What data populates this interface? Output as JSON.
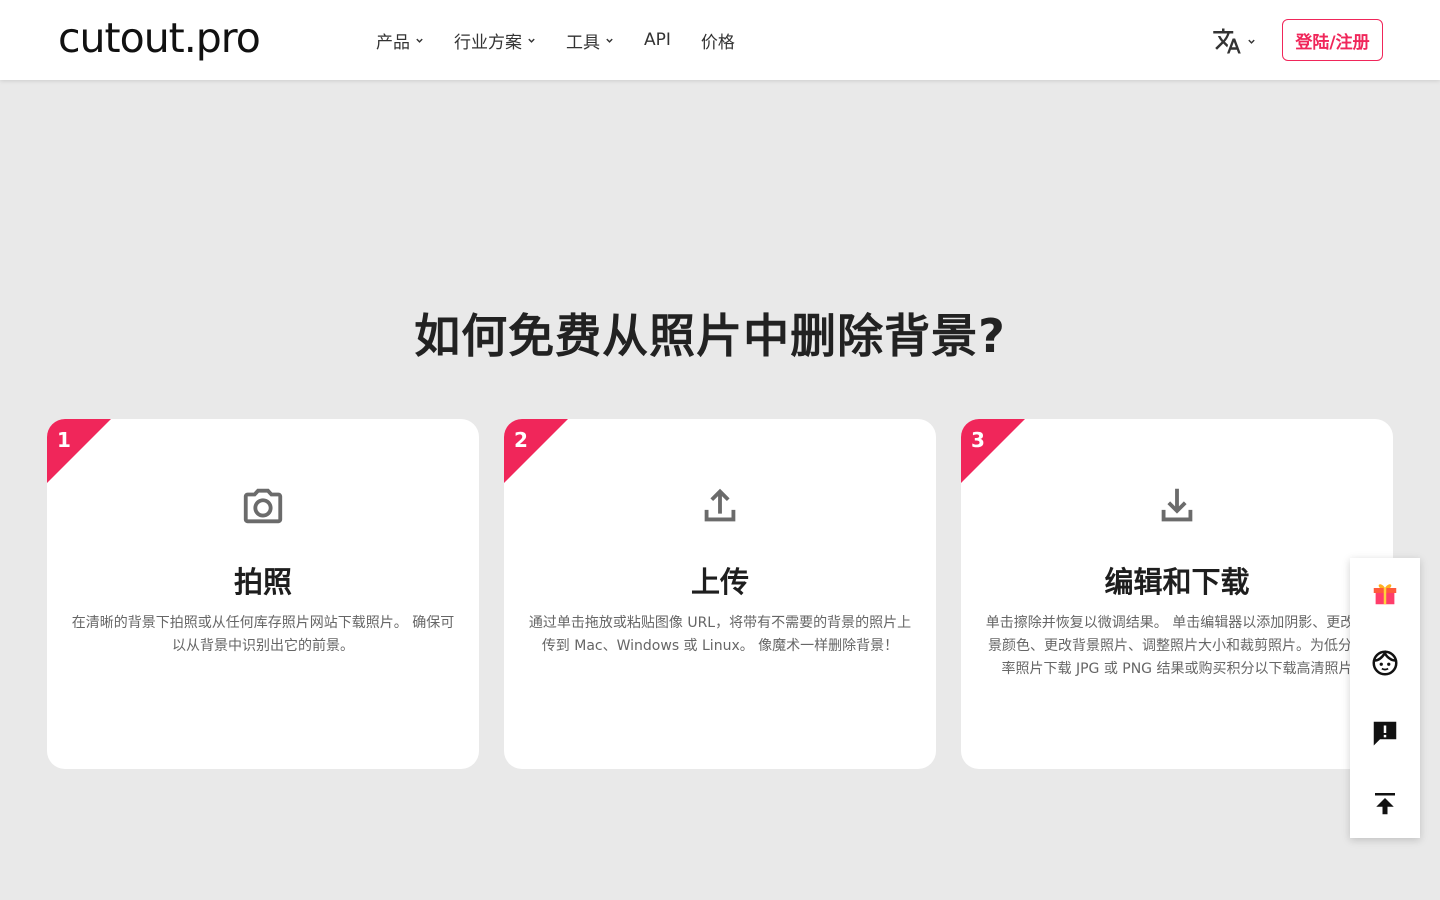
{
  "header": {
    "logo": "cutout.pro",
    "nav": [
      {
        "label": "产品",
        "has_dropdown": true
      },
      {
        "label": "行业方案",
        "has_dropdown": true
      },
      {
        "label": "工具",
        "has_dropdown": true
      },
      {
        "label": "API",
        "has_dropdown": false
      },
      {
        "label": "价格",
        "has_dropdown": false
      }
    ],
    "language_icon": "translate-icon",
    "login_label": "登陆/注册"
  },
  "section": {
    "title": "如何免费从照片中删除背景?"
  },
  "steps": [
    {
      "number": "1",
      "icon": "camera-icon",
      "title": "拍照",
      "description": "在清晰的背景下拍照或从任何库存照片网站下载照片。 确保可以从背景中识别出它的前景。"
    },
    {
      "number": "2",
      "icon": "upload-icon",
      "title": "上传",
      "description": "通过单击拖放或粘贴图像 URL，将带有不需要的背景的照片上传到 Mac、Windows 或 Linux。 像魔术一样删除背景！"
    },
    {
      "number": "3",
      "icon": "download-icon",
      "title": "编辑和下载",
      "description": "单击擦除并恢复以微调结果。 单击编辑器以添加阴影、更改背景颜色、更改背景照片、调整照片大小和裁剪照片。为低分辨率照片下载 JPG 或 PNG 结果或购买积分以下载高清照片"
    }
  ],
  "side_panel": [
    {
      "name": "gift-icon"
    },
    {
      "name": "customer-service-icon"
    },
    {
      "name": "feedback-icon"
    },
    {
      "name": "back-to-top-icon"
    }
  ],
  "colors": {
    "accent": "#f0265a",
    "background": "#e9e9e9",
    "icon_gray": "#6b6b6b"
  }
}
